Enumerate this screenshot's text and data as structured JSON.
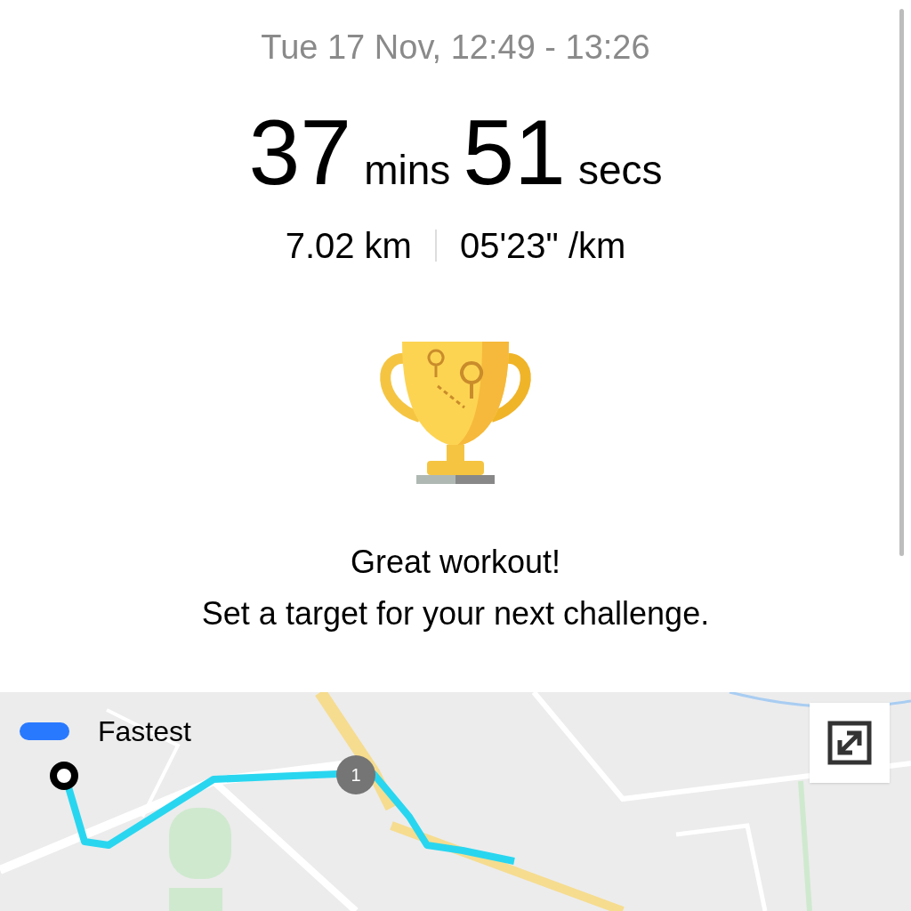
{
  "date_range": "Tue 17 Nov, 12:49 - 13:26",
  "duration": [
    {
      "value": "37",
      "unit": "mins"
    },
    {
      "value": "51",
      "unit": "secs"
    }
  ],
  "stats": [
    "7.02 km",
    "05'23\" /km"
  ],
  "message": {
    "title": "Great workout!",
    "subtitle": "Set a target for your next challenge."
  },
  "map": {
    "legend": {
      "label": "Fastest",
      "color": "#2979ff"
    },
    "split_marker": "1"
  }
}
